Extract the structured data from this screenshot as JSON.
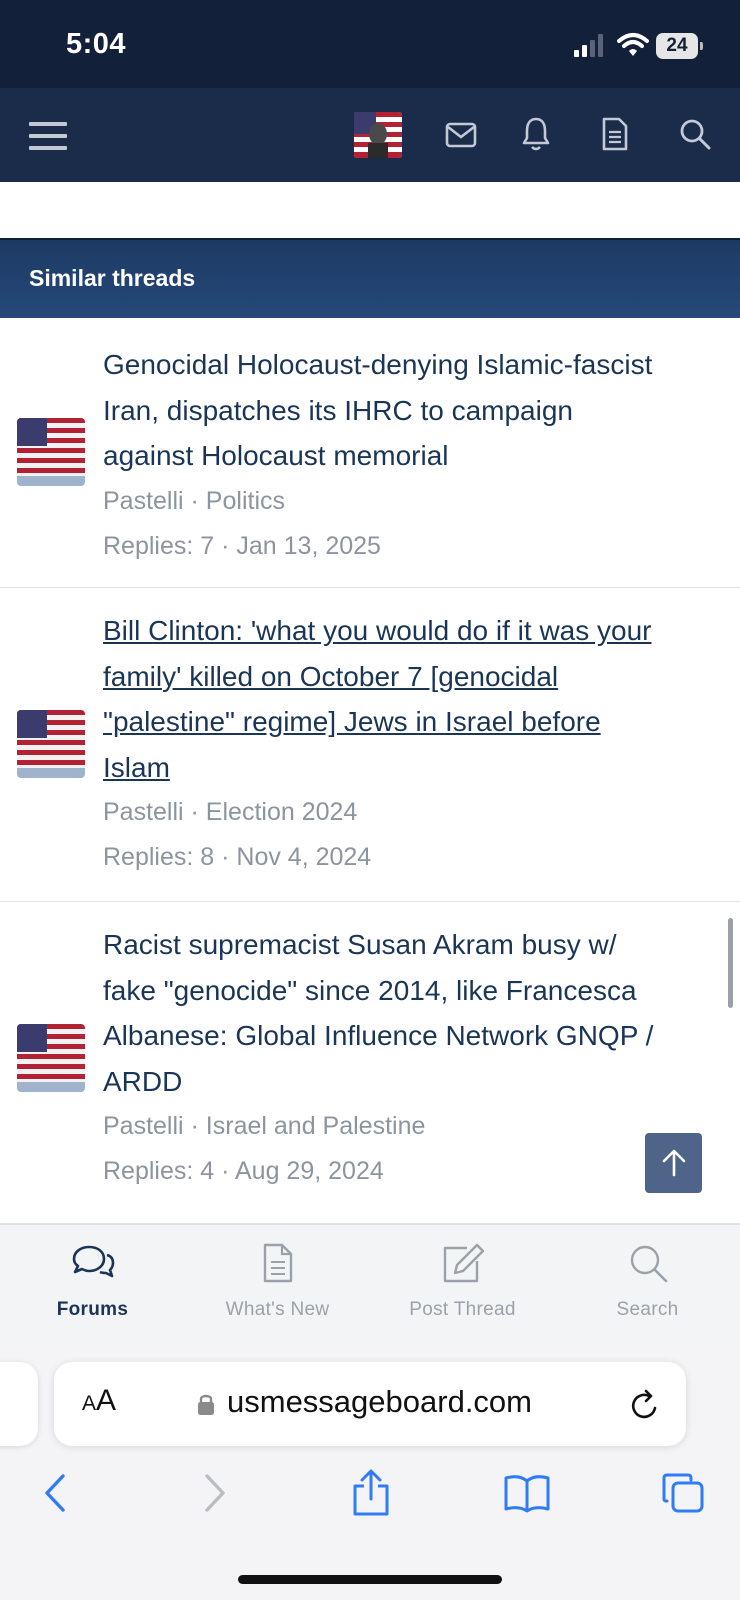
{
  "status_bar": {
    "time": "5:04",
    "battery": "24"
  },
  "header": {
    "icons": [
      "menu-icon",
      "user-avatar",
      "mail-icon",
      "bell-icon",
      "document-icon",
      "search-icon"
    ]
  },
  "section": {
    "title": "Similar threads"
  },
  "threads": [
    {
      "title_lines": [
        "Genocidal Holocaust-denying Islamic-fascist",
        "Iran, dispatches its IHRC to campaign",
        "against Holocaust memorial"
      ],
      "author": "Pastelli",
      "forum": "Politics",
      "meta_line": "Pastelli · Politics",
      "replies_line": "Replies: 7 · Jan 13, 2025",
      "visited": false
    },
    {
      "title_lines": [
        "Bill Clinton: 'what you would do if it was your",
        "family' killed on October 7 [genocidal",
        "\"palestine\" regime] Jews in Israel before",
        "Islam"
      ],
      "author": "Pastelli",
      "forum": "Election 2024",
      "meta_line": "Pastelli · Election 2024",
      "replies_line": "Replies: 8 · Nov 4, 2024",
      "visited": true
    },
    {
      "title_lines": [
        "Racist supremacist Susan Akram busy w/",
        "fake \"genocide\" since 2014, like Francesca",
        "Albanese: Global Influence Network GNQP /",
        "ARDD"
      ],
      "author": "Pastelli",
      "forum": "Israel and Palestine",
      "meta_line": "Pastelli · Israel and Palestine",
      "replies_line": "Replies: 4 · Aug 29, 2024",
      "visited": false
    }
  ],
  "bottom_nav": [
    {
      "label": "Forums",
      "icon": "chat-bubbles-icon",
      "active": true
    },
    {
      "label": "What's New",
      "icon": "document-icon",
      "active": false
    },
    {
      "label": "Post Thread",
      "icon": "edit-icon",
      "active": false
    },
    {
      "label": "Search",
      "icon": "search-icon",
      "active": false
    }
  ],
  "browser": {
    "aa_label_small": "A",
    "aa_label_large": "A",
    "url": "usmessageboard.com",
    "toolbar_icons": [
      "back-icon",
      "forward-icon",
      "share-icon",
      "bookmarks-icon",
      "tabs-icon"
    ]
  },
  "colors": {
    "header_bg": "#1a2c4a",
    "section_bar": "#26497a",
    "link_text": "#1b3557",
    "meta_text": "#8c959f",
    "ios_blue": "#2f7cf6"
  }
}
